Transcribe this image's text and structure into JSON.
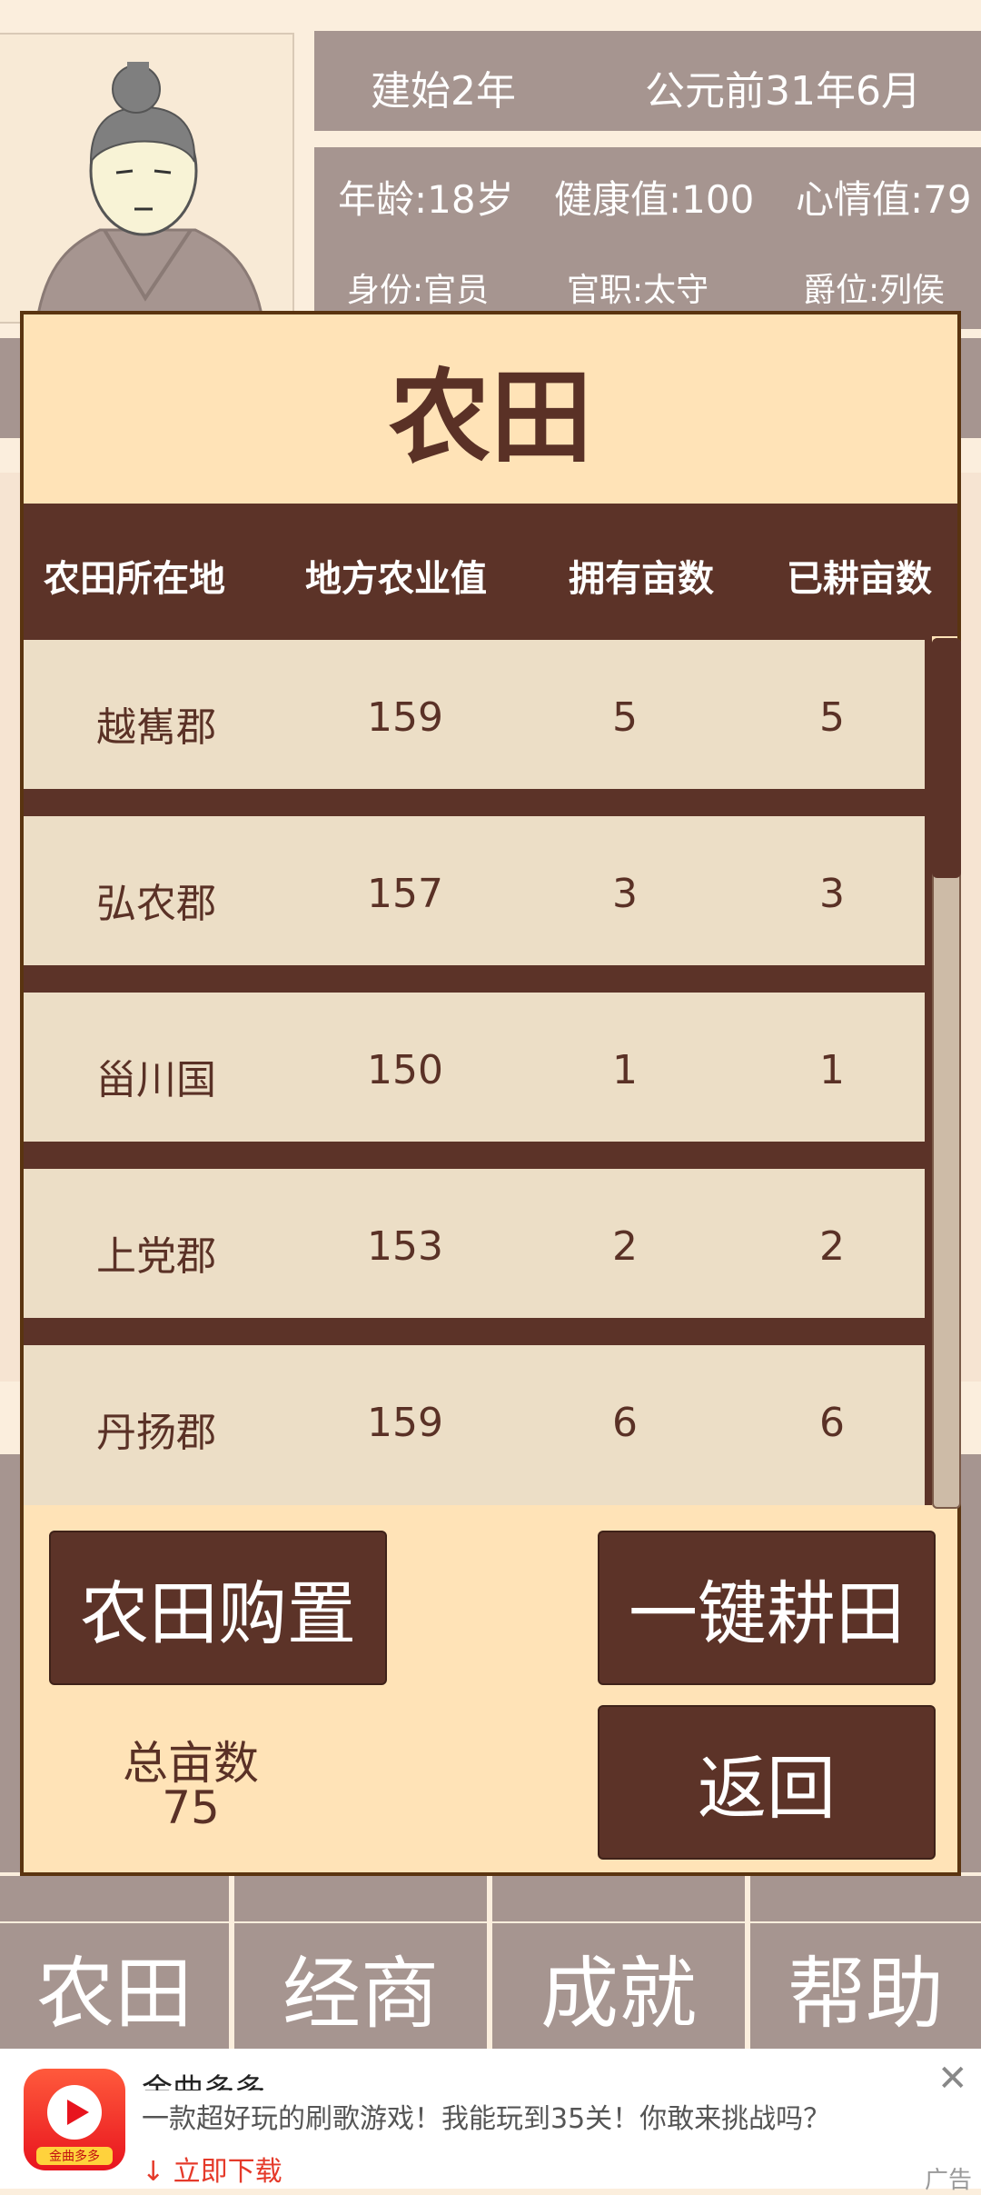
{
  "top": {
    "era": "建始2年",
    "date": "公元前31年6月",
    "age": "年龄:18岁",
    "health": "健康值:100",
    "mood": "心情值:79",
    "identity": "身份:官员",
    "office": "官职:太守",
    "rank": "爵位:列侯"
  },
  "modal": {
    "title": "农田",
    "headers": [
      "农田所在地",
      "地方农业值",
      "拥有亩数",
      "已耕亩数"
    ],
    "rows": [
      {
        "place": "越嶲郡",
        "value": "159",
        "owned": "5",
        "plowed": "5"
      },
      {
        "place": "弘农郡",
        "value": "157",
        "owned": "3",
        "plowed": "3"
      },
      {
        "place": "甾川国",
        "value": "150",
        "owned": "1",
        "plowed": "1"
      },
      {
        "place": "上党郡",
        "value": "153",
        "owned": "2",
        "plowed": "2"
      },
      {
        "place": "丹扬郡",
        "value": "159",
        "owned": "6",
        "plowed": "6"
      }
    ],
    "buy_label": "农田购置",
    "plow_label": "一键耕田",
    "back_label": "返回",
    "total_label": "总亩数",
    "total_value": "75",
    "scroll_fraction": 0.27
  },
  "nav": [
    "农田",
    "经商",
    "成就",
    "帮助"
  ],
  "ad": {
    "title": "金曲多多",
    "description": "一款超好玩的刷歌游戏！我能玩到35关！你敢来挑战吗？",
    "cta": "↓ 立即下载",
    "logo_text": "金曲多多",
    "tag": "广告"
  },
  "colors": {
    "accent": "#5c3328",
    "panel": "#ffe3b7",
    "muted": "#a69590"
  }
}
